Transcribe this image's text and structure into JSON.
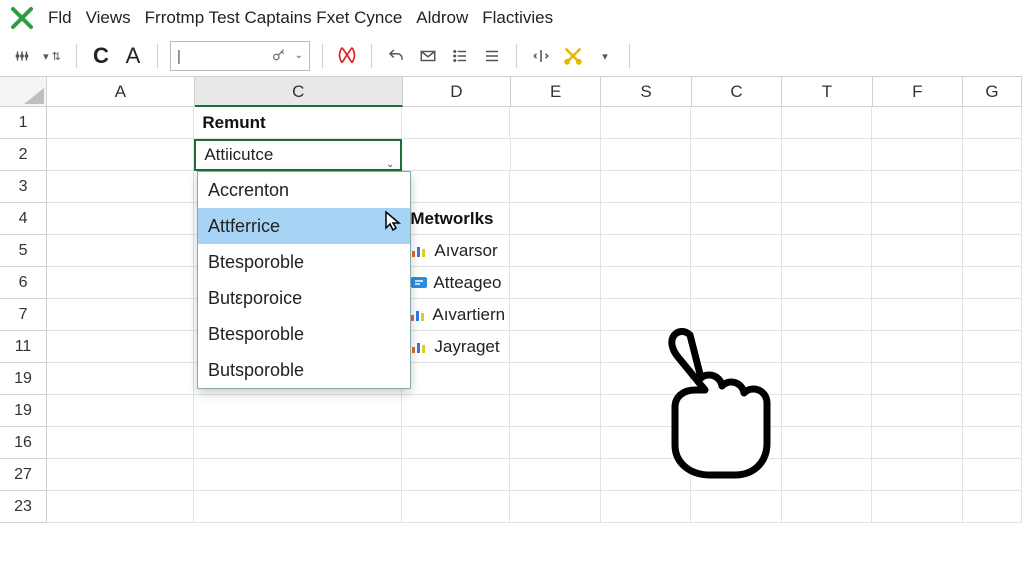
{
  "menu": [
    "Fld",
    "Views",
    "Frrotmp Test Captains Fxet Cynce",
    "Aldrow",
    "Flactivies"
  ],
  "toolbar": {
    "letter_c": "C",
    "letter_a": "A",
    "search_caret": "|"
  },
  "columns": [
    "A",
    "C",
    "D",
    "E",
    "S",
    "C",
    "T",
    "F",
    "G"
  ],
  "selected_column_index": 1,
  "row_headers": [
    "1",
    "2",
    "3",
    "4",
    "5",
    "6",
    "7",
    "11",
    "19",
    "19",
    "16",
    "27",
    "23"
  ],
  "cells": {
    "c1": "Remunt",
    "c2_value": "Attiicutce",
    "d4": "Metworlks",
    "d5": "Aıvarsor",
    "d6": "Atteageo",
    "d7": "Aıvartiern",
    "d11": "Jayraget"
  },
  "dropdown": {
    "items": [
      "Accrenton",
      "Attferrice",
      "Btesporoble",
      "Butεporoice",
      "Btesporoble",
      "Butsporoble"
    ],
    "hover_index": 1
  },
  "chart_data": {
    "type": "table",
    "title": "Spreadsheet with data-validation dropdown",
    "columns": [
      "A",
      "C",
      "D",
      "E",
      "S",
      "C",
      "T",
      "F",
      "G"
    ],
    "rows": [
      {
        "r": "1",
        "C": "Remunt"
      },
      {
        "r": "2",
        "C": "Attiicutce"
      },
      {
        "r": "4",
        "D": "Metworlks"
      },
      {
        "r": "5",
        "D": "Aıvarsor"
      },
      {
        "r": "6",
        "D": "Atteageo"
      },
      {
        "r": "7",
        "D": "Aıvartiern"
      },
      {
        "r": "11",
        "D": "Jayraget"
      }
    ],
    "dropdown_options": [
      "Accrenton",
      "Attferrice",
      "Btesporoble",
      "Butεporoice",
      "Btesporoble",
      "Butsporoble"
    ]
  }
}
